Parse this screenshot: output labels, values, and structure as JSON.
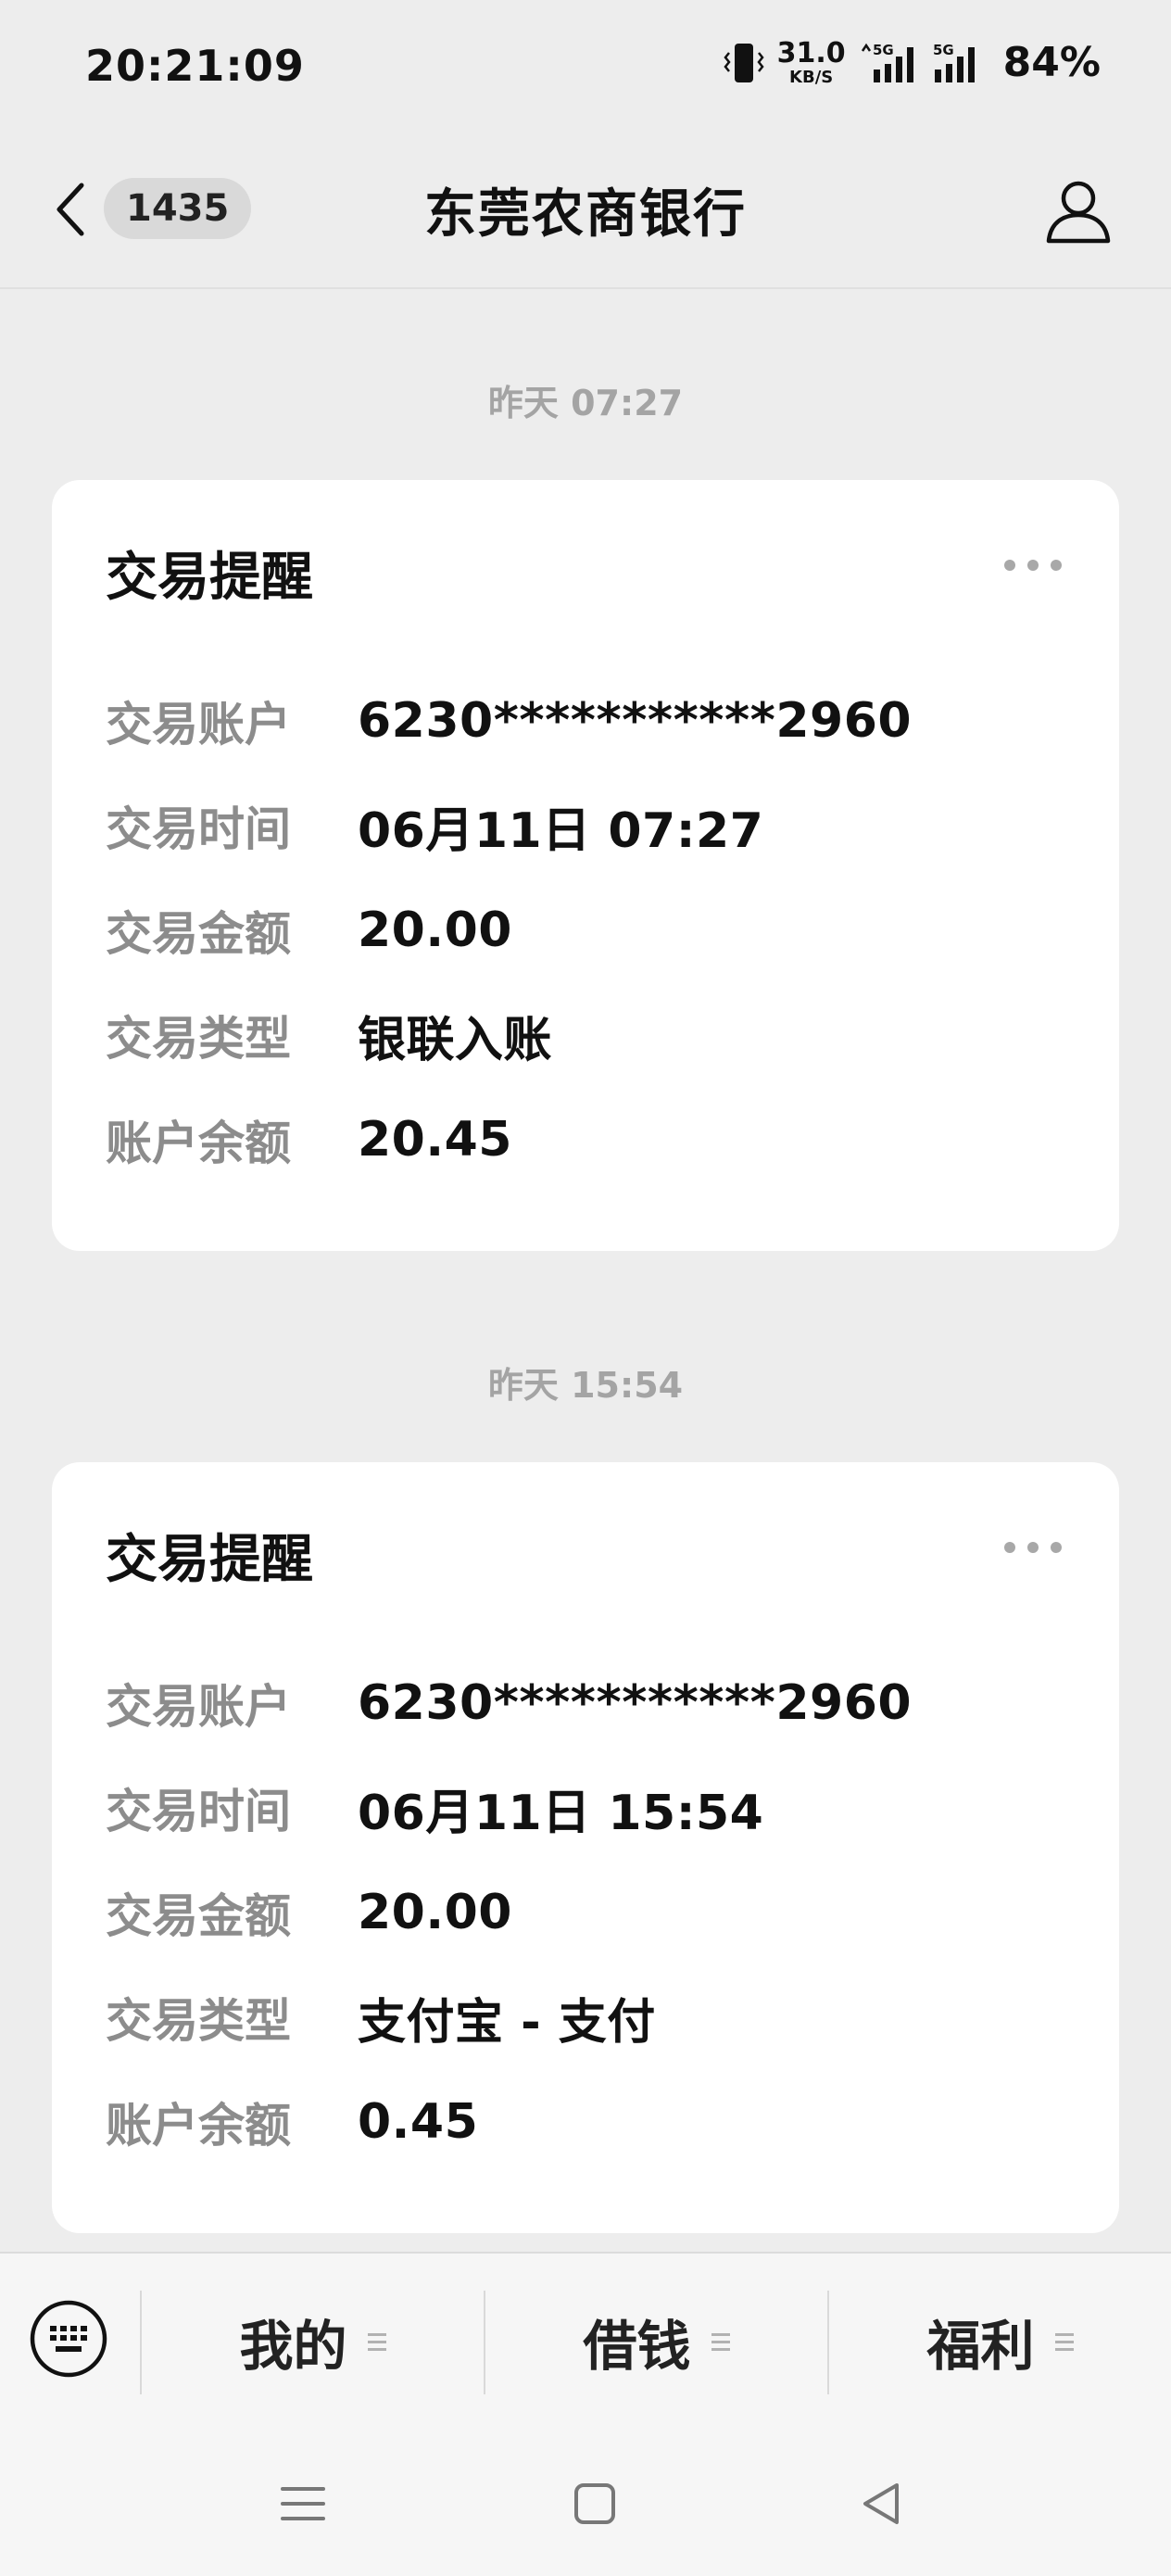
{
  "status_bar": {
    "time": "20:21:09",
    "network_speed": "31.0",
    "network_speed_unit": "KB/S",
    "signal1_label": "5G",
    "signal2_label": "5G",
    "battery": "84%"
  },
  "header": {
    "unread_count": "1435",
    "title": "东莞农商银行"
  },
  "messages": [
    {
      "timestamp": "昨天 07:27",
      "title": "交易提醒",
      "rows": [
        {
          "label": "交易账户",
          "value": "6230***********2960"
        },
        {
          "label": "交易时间",
          "value": "06月11日 07:27"
        },
        {
          "label": "交易金额",
          "value": "20.00"
        },
        {
          "label": "交易类型",
          "value": "银联入账"
        },
        {
          "label": "账户余额",
          "value": "20.45"
        }
      ]
    },
    {
      "timestamp": "昨天 15:54",
      "title": "交易提醒",
      "rows": [
        {
          "label": "交易账户",
          "value": "6230***********2960"
        },
        {
          "label": "交易时间",
          "value": "06月11日 15:54"
        },
        {
          "label": "交易金额",
          "value": "20.00"
        },
        {
          "label": "交易类型",
          "value": "支付宝 - 支付"
        },
        {
          "label": "账户余额",
          "value": "0.45"
        }
      ]
    }
  ],
  "bottom_menu": {
    "items": [
      {
        "label": "我的"
      },
      {
        "label": "借钱"
      },
      {
        "label": "福利"
      }
    ]
  },
  "colors": {
    "background": "#ededed",
    "card": "#ffffff",
    "label_gray": "#8c8c8c",
    "timestamp_gray": "#a4a4a4"
  }
}
